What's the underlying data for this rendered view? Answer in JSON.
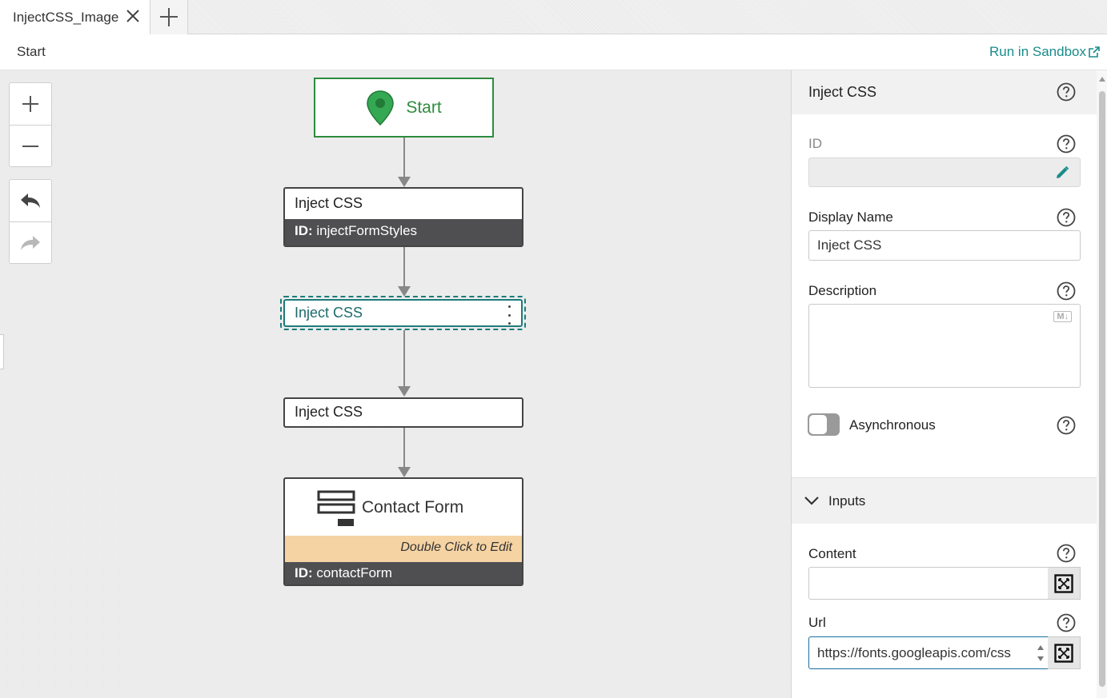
{
  "tabs": [
    {
      "label": "InjectCSS_Image"
    }
  ],
  "header": {
    "breadcrumb": "Start",
    "sandbox_link": "Run in Sandbox"
  },
  "canvas": {
    "start_node": {
      "label": "Start"
    },
    "nodes": [
      {
        "title": "Inject CSS",
        "id_prefix": "ID:",
        "id_value": "injectFormStyles"
      },
      {
        "title": "Inject CSS"
      },
      {
        "title": "Inject CSS"
      },
      {
        "title": "Contact Form",
        "hint": "Double Click to Edit",
        "id_prefix": "ID:",
        "id_value": "contactForm"
      }
    ]
  },
  "panel": {
    "title": "Inject CSS",
    "id_label": "ID",
    "id_value": "",
    "display_name_label": "Display Name",
    "display_name_value": "Inject CSS",
    "description_label": "Description",
    "description_value": "",
    "markdown_badge": "M↓",
    "async_label": "Asynchronous",
    "async_on": false,
    "inputs_section": "Inputs",
    "content_label": "Content",
    "content_value": "",
    "url_label": "Url",
    "url_value": "https://fonts.googleapis.com/css"
  },
  "colors": {
    "accent": "#1a8b8b",
    "start": "#2e8b3e",
    "node_dark": "#4f4f52",
    "hint_bg": "#f5d3a3"
  }
}
